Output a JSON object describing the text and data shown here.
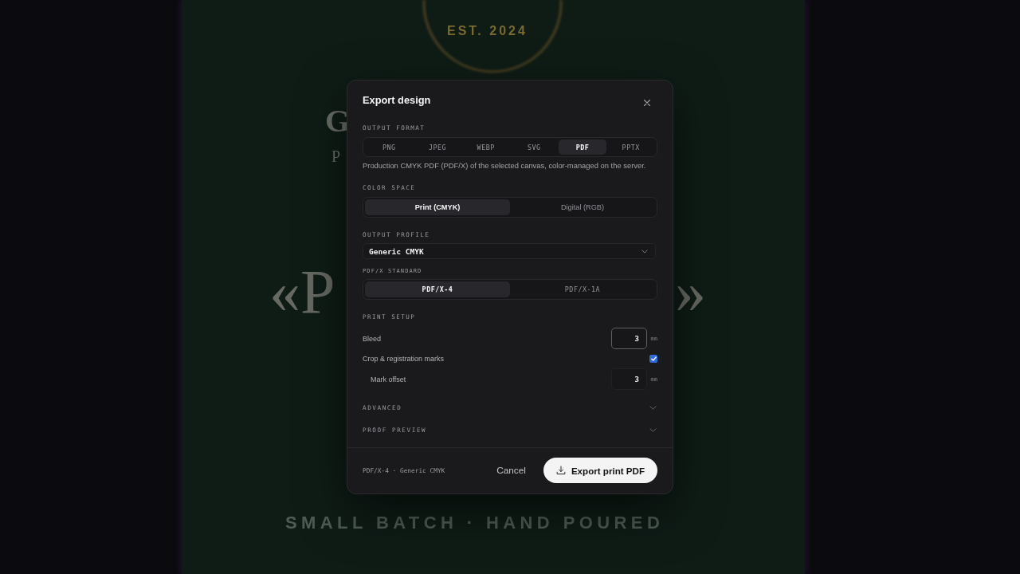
{
  "poster": {
    "emblem_text": "EST. 2024",
    "heading_fragment": "G",
    "subheading_fragment": "P",
    "quote_left_fragment": "«P",
    "quote_right_fragment": "»",
    "tagline": "SMALL BATCH · HAND POURED"
  },
  "dialog": {
    "title": "Export design"
  },
  "output_format": {
    "label": "OUTPUT FORMAT",
    "options": [
      {
        "label": "PNG",
        "selected": false
      },
      {
        "label": "JPEG",
        "selected": false
      },
      {
        "label": "WEBP",
        "selected": false
      },
      {
        "label": "SVG",
        "selected": false
      },
      {
        "label": "PDF",
        "selected": true
      },
      {
        "label": "PPTX",
        "selected": false
      }
    ],
    "description": "Production CMYK PDF (PDF/X) of the selected canvas, color-managed on the server."
  },
  "color_space": {
    "label": "COLOR SPACE",
    "options": [
      {
        "label": "Print (CMYK)",
        "selected": true
      },
      {
        "label": "Digital (RGB)",
        "selected": false
      }
    ]
  },
  "output_profile": {
    "label": "OUTPUT PROFILE",
    "value": "Generic CMYK"
  },
  "pdfx_standard": {
    "label": "PDF/X STANDARD",
    "options": [
      {
        "label": "PDF/X-4",
        "selected": true
      },
      {
        "label": "PDF/X-1A",
        "selected": false
      }
    ]
  },
  "print_setup": {
    "label": "PRINT SETUP",
    "rows": [
      {
        "kind": "number",
        "label": "Bleed",
        "value": "3",
        "unit": "mm",
        "focused": true
      },
      {
        "kind": "checkbox",
        "label": "Crop & registration marks",
        "checked": true,
        "children": [
          {
            "kind": "number",
            "label": "Mark offset",
            "value": "3",
            "unit": "mm",
            "focused": false
          }
        ]
      }
    ]
  },
  "sections": [
    {
      "label": "ADVANCED",
      "expanded": false
    },
    {
      "label": "PROOF PREVIEW",
      "expanded": false
    }
  ],
  "footer": {
    "summary": "PDF/X-4 · Generic CMYK",
    "cancel_button": "Cancel",
    "export_button": "Export print PDF"
  }
}
